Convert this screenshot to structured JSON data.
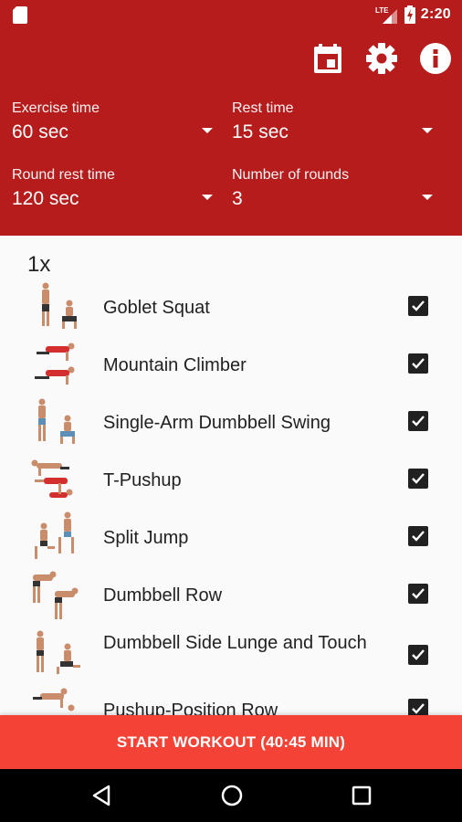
{
  "status_bar": {
    "time": "2:20",
    "network": "LTE",
    "icons": [
      "sd-card-icon",
      "signal-icon",
      "battery-icon"
    ]
  },
  "toolbar": {
    "icons": [
      "calendar-icon",
      "settings-gear-icon",
      "info-icon"
    ]
  },
  "settings": {
    "exercise_time": {
      "label": "Exercise time",
      "value": "60 sec"
    },
    "rest_time": {
      "label": "Rest time",
      "value": "15 sec"
    },
    "round_rest_time": {
      "label": "Round rest time",
      "value": "120 sec"
    },
    "number_of_rounds": {
      "label": "Number of rounds",
      "value": "3"
    }
  },
  "list": {
    "multiplier": "1x",
    "exercises": [
      {
        "name": "Goblet Squat",
        "checked": true
      },
      {
        "name": "Mountain Climber",
        "checked": true
      },
      {
        "name": "Single-Arm Dumbbell Swing",
        "checked": true
      },
      {
        "name": "T-Pushup",
        "checked": true
      },
      {
        "name": "Split Jump",
        "checked": true
      },
      {
        "name": "Dumbbell Row",
        "checked": true
      },
      {
        "name": "Dumbbell Side Lunge and Touch",
        "checked": true
      },
      {
        "name": "Pushup-Position Row",
        "checked": true
      }
    ]
  },
  "start_button": {
    "label": "START WORKOUT (40:45 MIN)"
  },
  "nav_bar": {
    "icons": [
      "back-icon",
      "home-icon",
      "recent-apps-icon"
    ]
  },
  "colors": {
    "header": "#b71c1c",
    "start_button": "#f44336",
    "checkbox": "#212121"
  }
}
